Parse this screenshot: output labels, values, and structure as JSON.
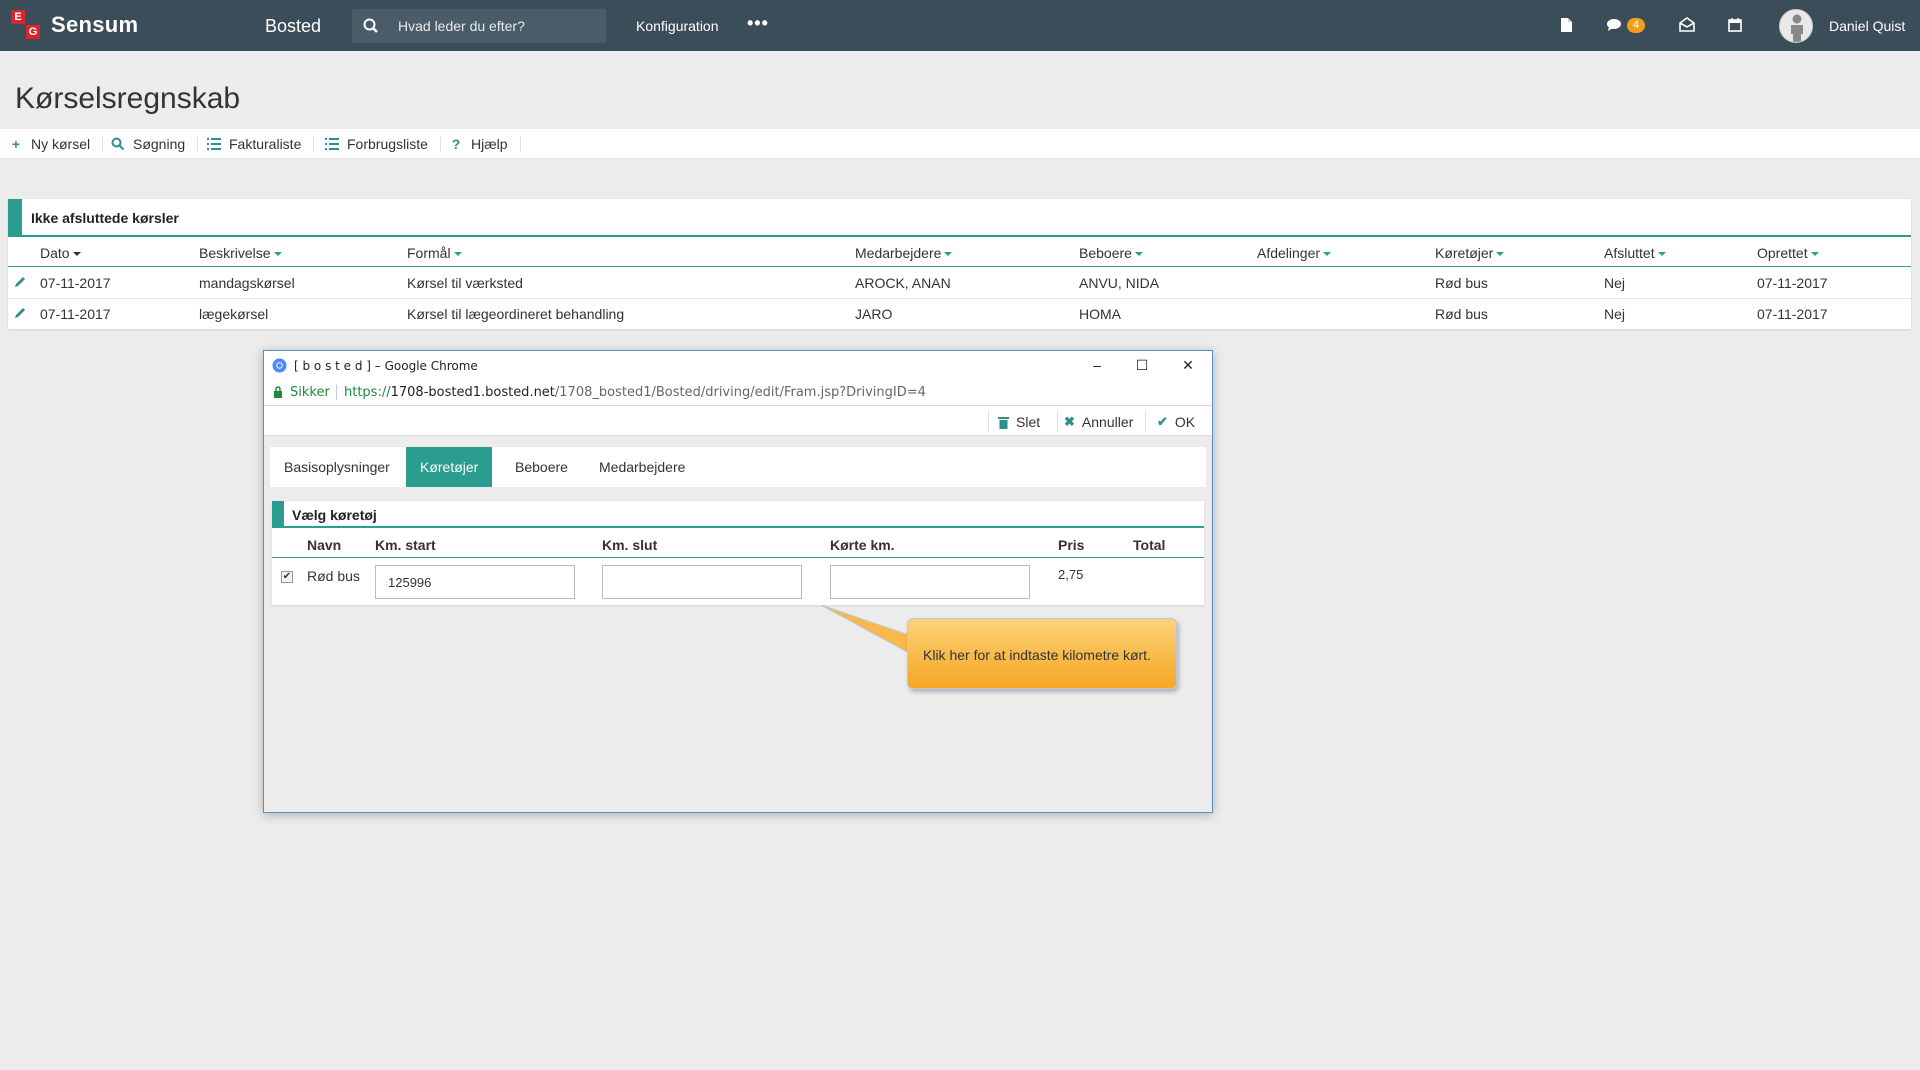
{
  "topbar": {
    "brand": "Sensum",
    "logo_letters": [
      "E",
      "G"
    ],
    "app_name": "Bosted",
    "search_placeholder": "Hvad leder du efter?",
    "config_label": "Konfiguration",
    "more_label": "•••",
    "icons": [
      "document-icon",
      "chat-icon",
      "mail-icon",
      "calendar-icon"
    ],
    "chat_badge": "4",
    "user_name": "Daniel Quist"
  },
  "page": {
    "title": "Kørselsregnskab"
  },
  "toolbar": {
    "items": [
      {
        "icon": "plus-icon",
        "label": "Ny kørsel"
      },
      {
        "icon": "search-icon",
        "label": "Søgning"
      },
      {
        "icon": "list-icon",
        "label": "Fakturaliste"
      },
      {
        "icon": "list-icon",
        "label": "Forbrugsliste"
      },
      {
        "icon": "help-icon",
        "label": "Hjælp"
      }
    ]
  },
  "panel": {
    "title": "Ikke afsluttede kørsler",
    "columns": [
      "Dato",
      "Beskrivelse",
      "Formål",
      "Medarbejdere",
      "Beboere",
      "Afdelinger",
      "Køretøjer",
      "Afsluttet",
      "Oprettet"
    ],
    "rows": [
      [
        "07-11-2017",
        "mandagskørsel",
        "Kørsel til værksted",
        "AROCK, ANAN",
        "ANVU, NIDA",
        "",
        "Rød bus",
        "Nej",
        "07-11-2017"
      ],
      [
        "07-11-2017",
        "lægekørsel",
        "Kørsel til lægeordineret behandling",
        "JARO",
        "HOMA",
        "",
        "Rød bus",
        "Nej",
        "07-11-2017"
      ]
    ]
  },
  "popup": {
    "window_title": "[ b o s t e d ] – Google Chrome",
    "secure_label": "Sikker",
    "url_scheme": "https://",
    "url_host": "1708-bosted1.bosted.net",
    "url_path": "/1708_bosted1/Bosted/driving/edit/Fram.jsp?DrivingID=4",
    "actions": {
      "delete": "Slet",
      "cancel": "Annuller",
      "ok": "OK"
    },
    "tabs": [
      "Basisoplysninger",
      "Køretøjer",
      "Beboere",
      "Medarbejdere"
    ],
    "active_tab": "Køretøjer",
    "vehicle_panel": {
      "title": "Vælg køretøj",
      "columns": [
        "Navn",
        "Km. start",
        "Km. slut",
        "Kørte km.",
        "Pris",
        "Total"
      ],
      "row": {
        "checked": true,
        "name": "Rød bus",
        "km_start": "125996",
        "km_end": "",
        "km_driven": "",
        "price": "2,75",
        "total": ""
      }
    },
    "tooltip": "Klik her for at indtaste kilometre kørt."
  },
  "colors": {
    "topbar": "#3b4d59",
    "accent": "#2a9d8f",
    "badge": "#f0a01b",
    "logo_red": "#d9262c"
  }
}
